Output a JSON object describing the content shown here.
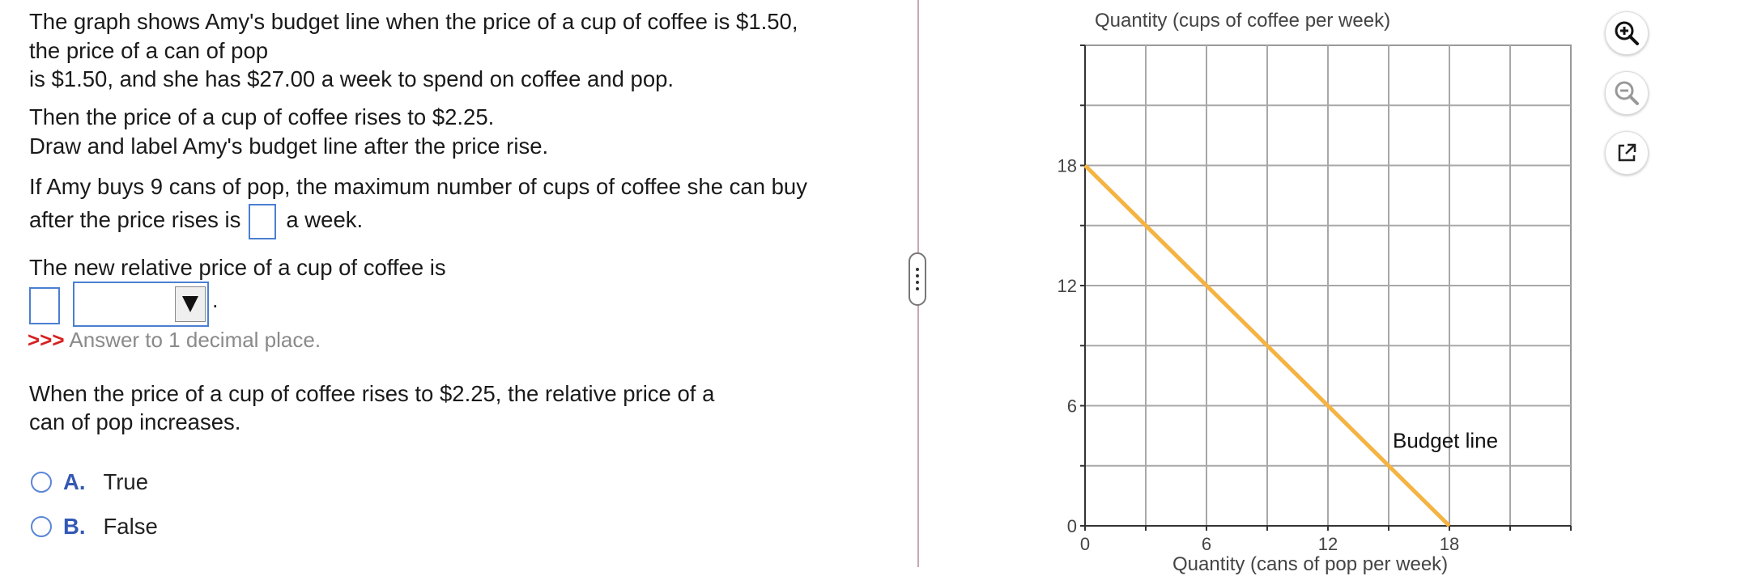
{
  "question": {
    "para1_line1": "The graph shows Amy's budget line when the price of a cup of coffee is $1.50,",
    "para1_line2": "the price of a can of pop",
    "para1_line3": "is $1.50, and she has $27.00 a week to spend on coffee and pop.",
    "para2_line1": "Then the price of a cup of coffee rises to $2.25.",
    "para2_line2": "Draw and label Amy's budget line after the price rise.",
    "para3_line1": "If Amy buys 9 cans of pop, the maximum number of cups of coffee she can buy",
    "para3_pre": "after the price rises is",
    "para3_post": "a week.",
    "para4": "The new relative price of a cup of coffee is",
    "select_period": ".",
    "hint_chevrons": ">>>",
    "hint_text": "Answer to 1 decimal place.",
    "para5_line1": "When the price of a cup of coffee rises to $2.25, the relative price of a",
    "para5_line2": "can of pop increases.",
    "choices": [
      {
        "letter": "A.",
        "label": "True"
      },
      {
        "letter": "B.",
        "label": "False"
      }
    ]
  },
  "tools": {
    "zoom_in_icon": "zoom-in-icon",
    "zoom_out_icon": "zoom-out-icon",
    "popout_icon": "popout-icon"
  },
  "chart_data": {
    "type": "line",
    "title": "",
    "ylabel": "Quantity (cups of coffee per week)",
    "xlabel": "Quantity (cans of pop per week)",
    "xlim": [
      0,
      24
    ],
    "ylim": [
      0,
      24
    ],
    "x_ticks": [
      0,
      6,
      12,
      18
    ],
    "y_ticks": [
      0,
      6,
      12,
      18
    ],
    "grid": true,
    "series": [
      {
        "name": "Budget line",
        "color": "#f5b342",
        "points": [
          [
            0,
            18
          ],
          [
            18,
            0
          ]
        ]
      }
    ],
    "annotations": [
      {
        "text": "Budget line",
        "x": 15.2,
        "y": 3.9
      }
    ]
  }
}
